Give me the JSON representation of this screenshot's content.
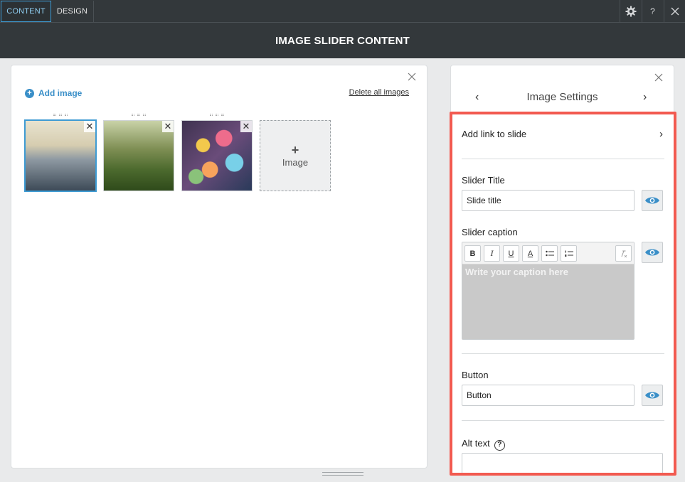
{
  "tabs": [
    {
      "label": "CONTENT",
      "active": true
    },
    {
      "label": "DESIGN",
      "active": false
    }
  ],
  "toolbar_icons": [
    "gear-icon",
    "help-icon",
    "close-icon"
  ],
  "toolbar_help_glyph": "?",
  "title": "IMAGE SLIDER CONTENT",
  "gallery": {
    "add_image_label": "Add image",
    "delete_all_label": "Delete all images",
    "images": [
      {
        "subject": "city skyline",
        "selected": true
      },
      {
        "subject": "birch forest",
        "selected": false
      },
      {
        "subject": "colorful bokeh lights",
        "selected": false
      }
    ],
    "remove_glyph": "✕",
    "add_tile_plus": "+",
    "add_tile_label": "Image"
  },
  "image_settings": {
    "title": "Image Settings",
    "prev_glyph": "‹",
    "next_glyph": "›",
    "add_link_label": "Add link to slide",
    "add_link_chevron": "›",
    "slider_title_label": "Slider Title",
    "slider_title_value": "Slide title",
    "slider_caption_label": "Slider caption",
    "caption_placeholder": "Write your caption here",
    "rte_buttons": {
      "bold": "B",
      "italic": "I",
      "underline": "U",
      "color": "A"
    },
    "button_label": "Button",
    "button_value": "Button",
    "alt_text_label": "Alt text",
    "alt_text_help": "?",
    "alt_text_value": ""
  },
  "colors": {
    "accent": "#3e9bd3",
    "highlight_frame": "#f25a50",
    "header_bg": "#33383b"
  }
}
